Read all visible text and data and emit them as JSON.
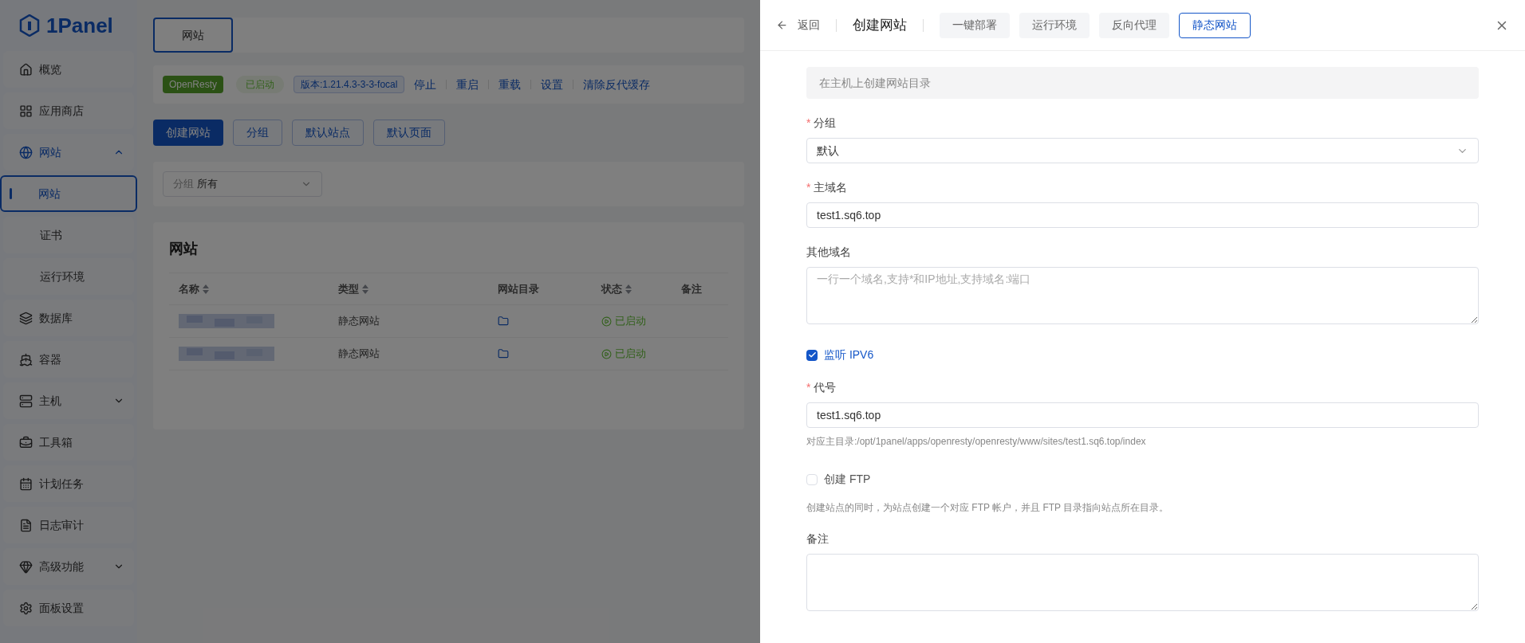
{
  "sidebar": {
    "logo": "1Panel",
    "items": [
      {
        "label": "概览"
      },
      {
        "label": "应用商店"
      },
      {
        "label": "网站",
        "expanded": true,
        "children": [
          {
            "label": "网站",
            "selected": true
          },
          {
            "label": "证书",
            "selected": false
          },
          {
            "label": "运行环境",
            "selected": false
          }
        ]
      },
      {
        "label": "数据库"
      },
      {
        "label": "容器"
      },
      {
        "label": "主机",
        "expanded": false
      },
      {
        "label": "工具箱"
      },
      {
        "label": "计划任务"
      },
      {
        "label": "日志审计"
      },
      {
        "label": "高级功能",
        "expanded": false
      },
      {
        "label": "面板设置"
      }
    ]
  },
  "main": {
    "tabs": [
      {
        "label": "网站",
        "selected": true
      }
    ],
    "app_bar": {
      "app": "OpenResty",
      "status": "已启动",
      "version": "版本:1.21.4.3-3-3-focal",
      "actions": [
        "停止",
        "重启",
        "重载",
        "设置",
        "清除反代缓存"
      ]
    },
    "buttons": [
      {
        "label": "创建网站",
        "kind": "primary"
      },
      {
        "label": "分组",
        "kind": "plain"
      },
      {
        "label": "默认站点",
        "kind": "plain"
      },
      {
        "label": "默认页面",
        "kind": "plain"
      }
    ],
    "filter": {
      "label": "分组",
      "value": "所有"
    },
    "table": {
      "title": "网站",
      "columns": [
        {
          "label": "名称",
          "sortable": true
        },
        {
          "label": "类型",
          "sortable": true
        },
        {
          "label": "网站目录",
          "sortable": false
        },
        {
          "label": "状态",
          "sortable": true
        },
        {
          "label": "备注",
          "sortable": false
        }
      ],
      "rows": [
        {
          "name_redacted": true,
          "type": "静态网站",
          "status": "已启动"
        },
        {
          "name_redacted": true,
          "type": "静态网站",
          "status": "已启动"
        }
      ]
    }
  },
  "drawer": {
    "back": "返回",
    "title": "创建网站",
    "tabs": [
      {
        "label": "一键部署",
        "selected": false
      },
      {
        "label": "运行环境",
        "selected": false
      },
      {
        "label": "反向代理",
        "selected": false
      },
      {
        "label": "静态网站",
        "selected": true
      }
    ],
    "notice": "在主机上创建网站目录",
    "fields": [
      {
        "kind": "select",
        "label": "分组",
        "required_mark": "*",
        "value": "默认"
      },
      {
        "kind": "input",
        "label": "主域名",
        "required_mark": "*",
        "value": "test1.sq6.top"
      },
      {
        "kind": "textarea",
        "label": "其他域名",
        "placeholder": "一行一个域名,支持*和IP地址,支持域名:端口"
      },
      {
        "kind": "checkbox",
        "label": "监听 IPV6",
        "checked": true
      },
      {
        "kind": "input",
        "label": "代号",
        "required_mark": "*",
        "value": "test1.sq6.top",
        "hint": "对应主目录:/opt/1panel/apps/openresty/openresty/www/sites/test1.sq6.top/index"
      },
      {
        "kind": "checkbox",
        "label": "创建 FTP",
        "checked": false,
        "hint": "创建站点的同时，为站点创建一个对应 FTP 帐户，并且 FTP 目录指向站点所在目录。"
      },
      {
        "kind": "textarea",
        "label": "备注"
      }
    ]
  }
}
